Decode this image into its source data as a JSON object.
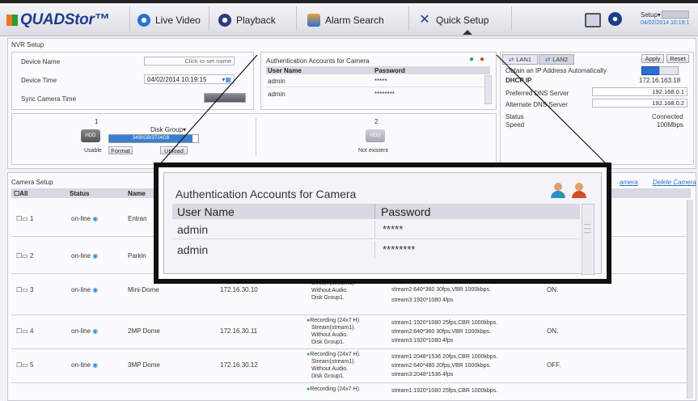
{
  "app": {
    "logo": "QUADStor™"
  },
  "nav": {
    "items": [
      {
        "label": "Live Video",
        "icon": "live-video-icon"
      },
      {
        "label": "Playback",
        "icon": "playback-icon"
      },
      {
        "label": "Alarm Search",
        "icon": "alarm-search-icon"
      },
      {
        "label": "Quick Setup",
        "icon": "quick-setup-icon"
      }
    ],
    "setup_label": "Setup",
    "datetime": "04/02/2014 10:19:1"
  },
  "nvr": {
    "title": "NVR Setup",
    "device_name_label": "Device Name",
    "device_name_placeholder": "Click to set name",
    "device_time_label": "Device Time",
    "device_time_value": "04/02/2014 10:19:15",
    "sync_label": "Sync Camera Time",
    "disk1": {
      "num": "1",
      "group": "Disk Group",
      "usage": "3490GB/3724GB",
      "status": "Usable",
      "format": "Format",
      "unload": "Unload"
    },
    "disk2": {
      "num": "2",
      "status": "Not existent"
    }
  },
  "auth_small": {
    "title": "Authentication Accounts for Camera",
    "col_user": "User Name",
    "col_pass": "Password",
    "rows": [
      {
        "user": "admin",
        "pass": "*****"
      },
      {
        "user": "admin",
        "pass": "********"
      }
    ]
  },
  "lan": {
    "tab1": "LAN1",
    "tab2": "LAN2",
    "apply": "Apply",
    "reset": "Reset",
    "obtain": "Obtain an IP Address Automatically",
    "dhcp_ip_label": "DHCP IP",
    "dhcp_ip": "172.16.163.18",
    "preferred_dns_label": "Preferred DNS Server",
    "preferred_dns": "192.168.0.1",
    "alternate_dns_label": "Alternate DNS Server",
    "alternate_dns": "192.168.0.2",
    "status_label": "Status",
    "status": "Connected",
    "speed_label": "Speed",
    "speed": "100Mbps"
  },
  "camera": {
    "title": "Camera Setup",
    "add_camera": "amera",
    "delete_camera": "Delete Camera",
    "headers": {
      "all": "All",
      "status": "Status",
      "name": "Name"
    },
    "rows": [
      {
        "id": "1",
        "status": "on-line",
        "name": "Entran",
        "ip": "",
        "rec": [],
        "streams": [],
        "flag": ""
      },
      {
        "id": "2",
        "status": "on-line",
        "name": "Parkin",
        "ip": "",
        "rec": [],
        "streams": [],
        "flag": ""
      },
      {
        "id": "3",
        "status": "on-line",
        "name": "Mini-Dome",
        "ip": "172.16.30.10",
        "rec": [
          "Stream(stream1).",
          "Without Audio.",
          "Disk Group1."
        ],
        "streams": [
          "stream2:640*360 30fps,VBR 1000kbps.",
          "stream3:1920*1080 4fps"
        ],
        "flag": "ON."
      },
      {
        "id": "4",
        "status": "on-line",
        "name": "2MP Dome",
        "ip": "172.16.30.11",
        "rec": [
          "Recording (24x7 H).",
          "Stream(stream1).",
          "Without Audio.",
          "Disk Group1."
        ],
        "streams": [
          "stream1:1920*1080 25fps,CBR 1000kbps.",
          "stream2:640*360 30fps,VBR 1000kbps.",
          "stream3:1920*1080 4fps"
        ],
        "flag": "ON."
      },
      {
        "id": "5",
        "status": "on-line",
        "name": "3MP Dome",
        "ip": "172.16.30.12",
        "rec": [
          "Recording (24x7 H).",
          "Stream(stream1).",
          "Without Audio.",
          "Disk Group1."
        ],
        "streams": [
          "stream1:2048*1536 20fps,CBR 1000kbps.",
          "stream2:640*480 20fps,VBR 1000kbps.",
          "stream3:2048*1536 4fps"
        ],
        "flag": "OFF."
      },
      {
        "id": "",
        "status": "",
        "name": "",
        "ip": "",
        "rec": [
          "Recording (24x7 H)."
        ],
        "streams": [
          "stream1:1920*1080 25fps,CBR 1000kbps."
        ],
        "flag": ""
      }
    ]
  },
  "zoom": {
    "title": "Authentication Accounts for Camera",
    "col_user": "User Name",
    "col_pass": "Password",
    "rows": [
      {
        "user": "admin",
        "pass": "*****"
      },
      {
        "user": "admin",
        "pass": "********"
      }
    ]
  },
  "colors": {
    "accent": "#1e3c8c",
    "online": "#2f8fd8",
    "recording": "#2aa84a",
    "disk_bar": "#3a7fd0"
  }
}
